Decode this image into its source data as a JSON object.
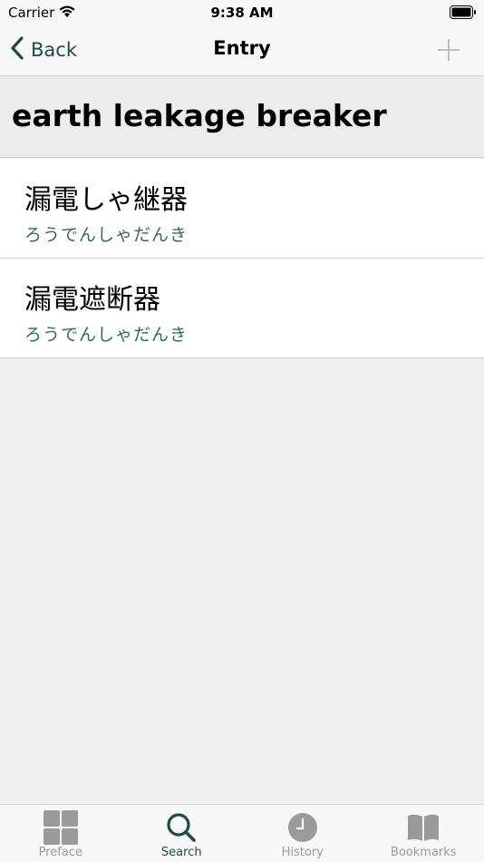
{
  "status_bar": {
    "carrier": "Carrier",
    "time": "9:38 AM"
  },
  "nav": {
    "back_label": "Back",
    "title": "Entry"
  },
  "term": "earth leakage breaker",
  "results": [
    {
      "word": "漏電しゃ継器",
      "reading": "ろうでんしゃだんき"
    },
    {
      "word": "漏電遮断器",
      "reading": "ろうでんしゃだんき"
    }
  ],
  "tabs": [
    {
      "label": "Preface",
      "icon": "preface-grid-icon"
    },
    {
      "label": "Search",
      "icon": "search-icon",
      "active": true
    },
    {
      "label": "History",
      "icon": "clock-icon"
    },
    {
      "label": "Bookmarks",
      "icon": "book-icon"
    }
  ],
  "colors": {
    "accent": "#1e4c44",
    "reading": "#2f6a5f",
    "inactive": "#9a9a9a"
  }
}
